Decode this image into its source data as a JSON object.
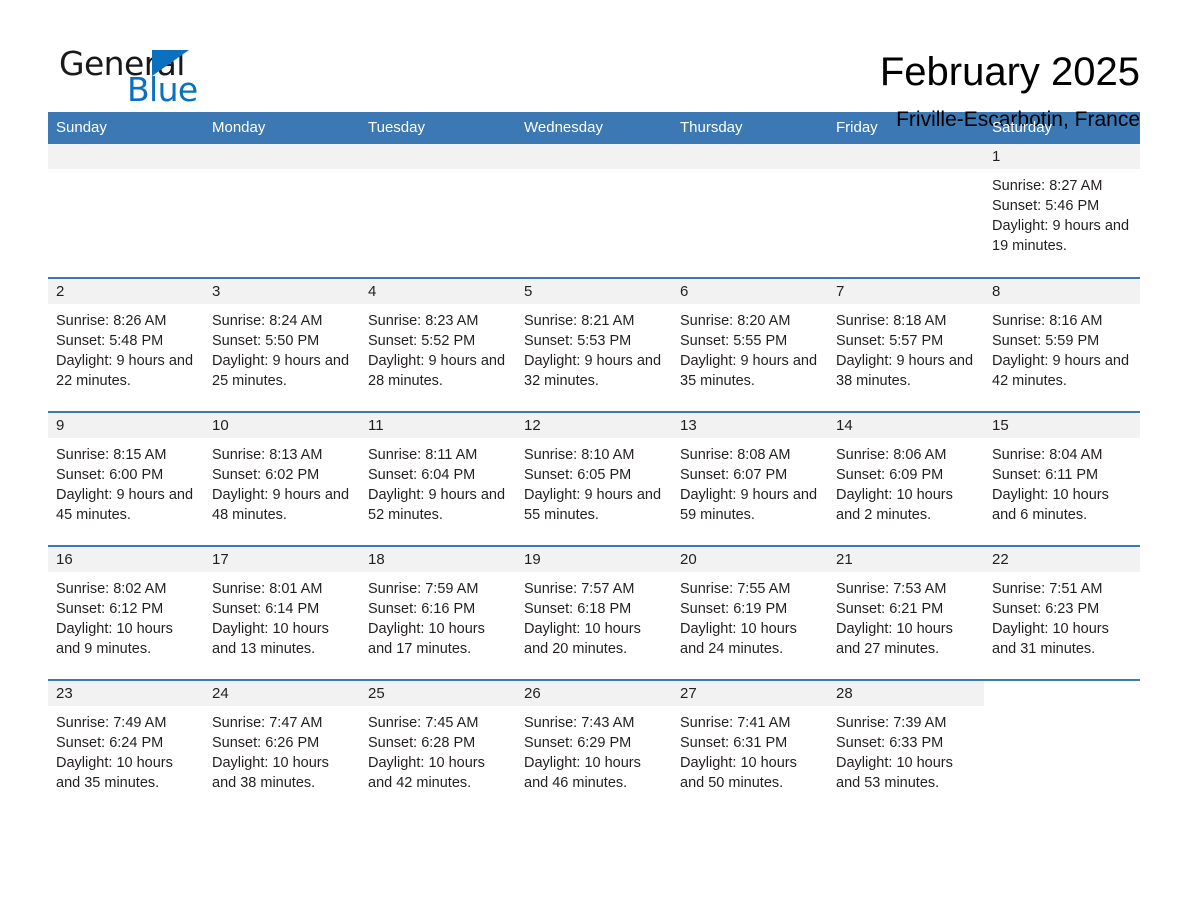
{
  "brand": {
    "name_part1": "General",
    "name_part2": "Blue",
    "triangle_icon": "triangle-icon",
    "accent_color": "#0a70c0"
  },
  "header": {
    "month_title": "February 2025",
    "location": "Friville-Escarbotin, France"
  },
  "calendar": {
    "header_bg": "#3b78b4",
    "daynum_bg": "#f2f2f2",
    "columns": [
      "Sunday",
      "Monday",
      "Tuesday",
      "Wednesday",
      "Thursday",
      "Friday",
      "Saturday"
    ],
    "labels": {
      "sunrise": "Sunrise:",
      "sunset": "Sunset:",
      "daylight": "Daylight:"
    },
    "weeks": [
      [
        {
          "day": "",
          "empty": true
        },
        {
          "day": "",
          "empty": true
        },
        {
          "day": "",
          "empty": true
        },
        {
          "day": "",
          "empty": true
        },
        {
          "day": "",
          "empty": true
        },
        {
          "day": "",
          "empty": true
        },
        {
          "day": "1",
          "sunrise": "Sunrise: 8:27 AM",
          "sunset": "Sunset: 5:46 PM",
          "daylight": "Daylight: 9 hours and 19 minutes."
        }
      ],
      [
        {
          "day": "2",
          "sunrise": "Sunrise: 8:26 AM",
          "sunset": "Sunset: 5:48 PM",
          "daylight": "Daylight: 9 hours and 22 minutes."
        },
        {
          "day": "3",
          "sunrise": "Sunrise: 8:24 AM",
          "sunset": "Sunset: 5:50 PM",
          "daylight": "Daylight: 9 hours and 25 minutes."
        },
        {
          "day": "4",
          "sunrise": "Sunrise: 8:23 AM",
          "sunset": "Sunset: 5:52 PM",
          "daylight": "Daylight: 9 hours and 28 minutes."
        },
        {
          "day": "5",
          "sunrise": "Sunrise: 8:21 AM",
          "sunset": "Sunset: 5:53 PM",
          "daylight": "Daylight: 9 hours and 32 minutes."
        },
        {
          "day": "6",
          "sunrise": "Sunrise: 8:20 AM",
          "sunset": "Sunset: 5:55 PM",
          "daylight": "Daylight: 9 hours and 35 minutes."
        },
        {
          "day": "7",
          "sunrise": "Sunrise: 8:18 AM",
          "sunset": "Sunset: 5:57 PM",
          "daylight": "Daylight: 9 hours and 38 minutes."
        },
        {
          "day": "8",
          "sunrise": "Sunrise: 8:16 AM",
          "sunset": "Sunset: 5:59 PM",
          "daylight": "Daylight: 9 hours and 42 minutes."
        }
      ],
      [
        {
          "day": "9",
          "sunrise": "Sunrise: 8:15 AM",
          "sunset": "Sunset: 6:00 PM",
          "daylight": "Daylight: 9 hours and 45 minutes."
        },
        {
          "day": "10",
          "sunrise": "Sunrise: 8:13 AM",
          "sunset": "Sunset: 6:02 PM",
          "daylight": "Daylight: 9 hours and 48 minutes."
        },
        {
          "day": "11",
          "sunrise": "Sunrise: 8:11 AM",
          "sunset": "Sunset: 6:04 PM",
          "daylight": "Daylight: 9 hours and 52 minutes."
        },
        {
          "day": "12",
          "sunrise": "Sunrise: 8:10 AM",
          "sunset": "Sunset: 6:05 PM",
          "daylight": "Daylight: 9 hours and 55 minutes."
        },
        {
          "day": "13",
          "sunrise": "Sunrise: 8:08 AM",
          "sunset": "Sunset: 6:07 PM",
          "daylight": "Daylight: 9 hours and 59 minutes."
        },
        {
          "day": "14",
          "sunrise": "Sunrise: 8:06 AM",
          "sunset": "Sunset: 6:09 PM",
          "daylight": "Daylight: 10 hours and 2 minutes."
        },
        {
          "day": "15",
          "sunrise": "Sunrise: 8:04 AM",
          "sunset": "Sunset: 6:11 PM",
          "daylight": "Daylight: 10 hours and 6 minutes."
        }
      ],
      [
        {
          "day": "16",
          "sunrise": "Sunrise: 8:02 AM",
          "sunset": "Sunset: 6:12 PM",
          "daylight": "Daylight: 10 hours and 9 minutes."
        },
        {
          "day": "17",
          "sunrise": "Sunrise: 8:01 AM",
          "sunset": "Sunset: 6:14 PM",
          "daylight": "Daylight: 10 hours and 13 minutes."
        },
        {
          "day": "18",
          "sunrise": "Sunrise: 7:59 AM",
          "sunset": "Sunset: 6:16 PM",
          "daylight": "Daylight: 10 hours and 17 minutes."
        },
        {
          "day": "19",
          "sunrise": "Sunrise: 7:57 AM",
          "sunset": "Sunset: 6:18 PM",
          "daylight": "Daylight: 10 hours and 20 minutes."
        },
        {
          "day": "20",
          "sunrise": "Sunrise: 7:55 AM",
          "sunset": "Sunset: 6:19 PM",
          "daylight": "Daylight: 10 hours and 24 minutes."
        },
        {
          "day": "21",
          "sunrise": "Sunrise: 7:53 AM",
          "sunset": "Sunset: 6:21 PM",
          "daylight": "Daylight: 10 hours and 27 minutes."
        },
        {
          "day": "22",
          "sunrise": "Sunrise: 7:51 AM",
          "sunset": "Sunset: 6:23 PM",
          "daylight": "Daylight: 10 hours and 31 minutes."
        }
      ],
      [
        {
          "day": "23",
          "sunrise": "Sunrise: 7:49 AM",
          "sunset": "Sunset: 6:24 PM",
          "daylight": "Daylight: 10 hours and 35 minutes."
        },
        {
          "day": "24",
          "sunrise": "Sunrise: 7:47 AM",
          "sunset": "Sunset: 6:26 PM",
          "daylight": "Daylight: 10 hours and 38 minutes."
        },
        {
          "day": "25",
          "sunrise": "Sunrise: 7:45 AM",
          "sunset": "Sunset: 6:28 PM",
          "daylight": "Daylight: 10 hours and 42 minutes."
        },
        {
          "day": "26",
          "sunrise": "Sunrise: 7:43 AM",
          "sunset": "Sunset: 6:29 PM",
          "daylight": "Daylight: 10 hours and 46 minutes."
        },
        {
          "day": "27",
          "sunrise": "Sunrise: 7:41 AM",
          "sunset": "Sunset: 6:31 PM",
          "daylight": "Daylight: 10 hours and 50 minutes."
        },
        {
          "day": "28",
          "sunrise": "Sunrise: 7:39 AM",
          "sunset": "Sunset: 6:33 PM",
          "daylight": "Daylight: 10 hours and 53 minutes."
        },
        {
          "day": "",
          "blank": true
        }
      ]
    ]
  }
}
